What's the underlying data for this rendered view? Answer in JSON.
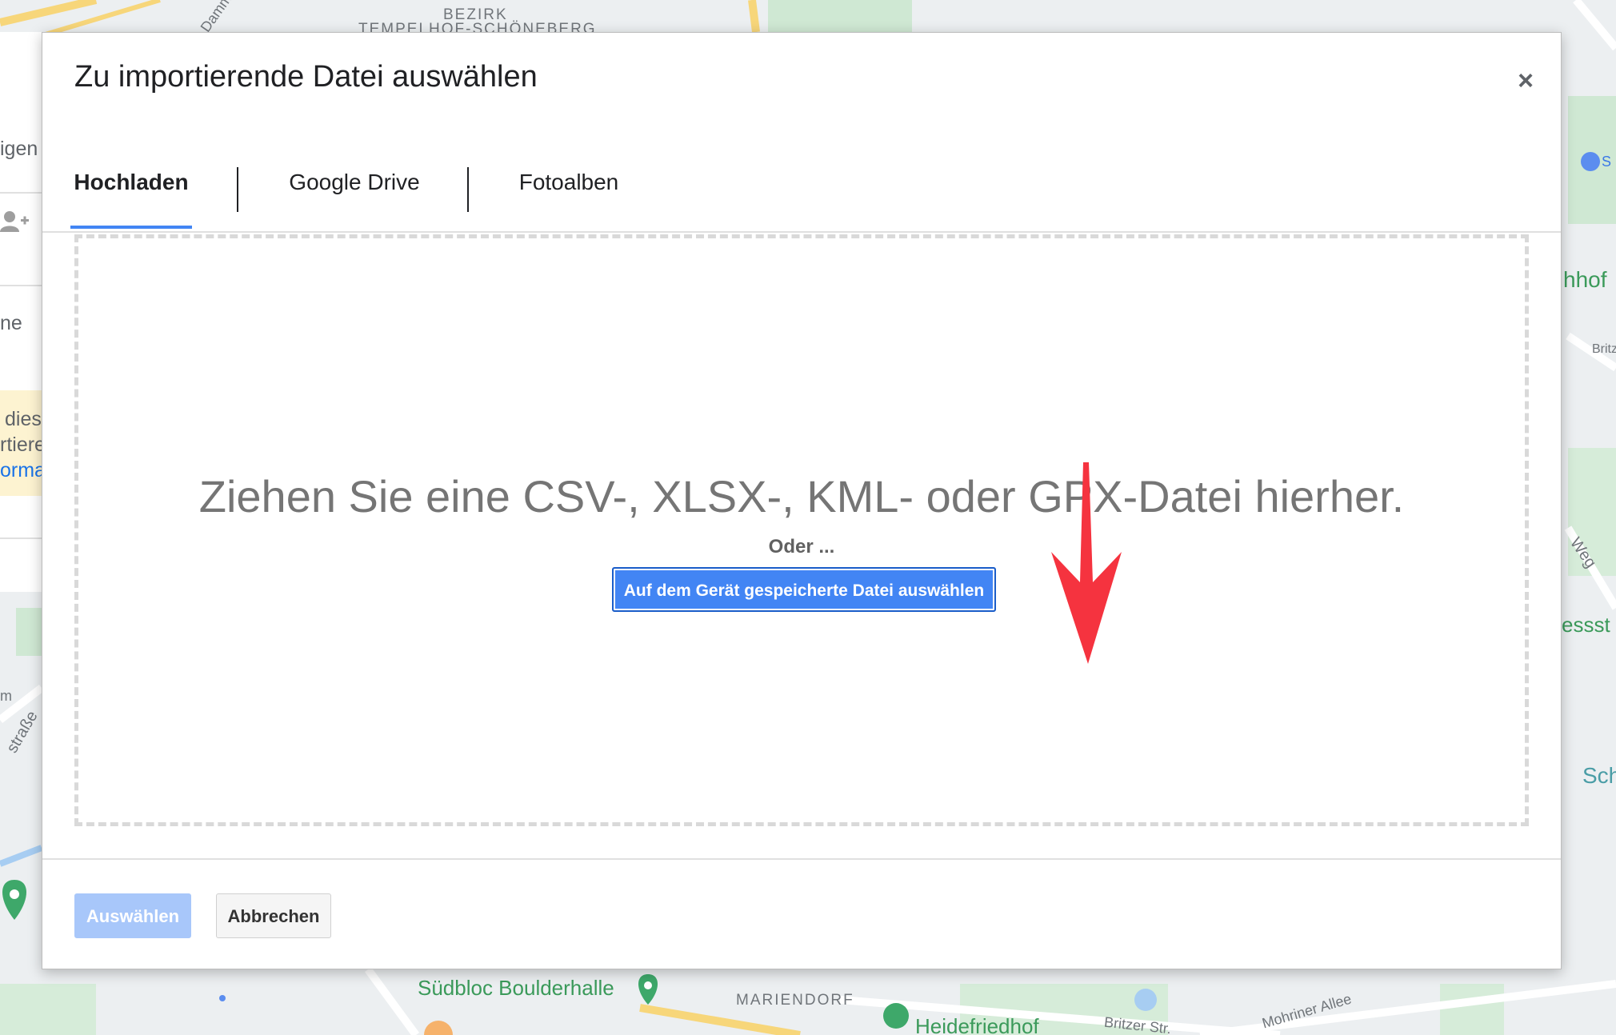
{
  "map": {
    "labels": {
      "district": "BEZIRK",
      "district_name": "TEMPELHOF-SCHÖNEBERG",
      "street_damm": "Damm",
      "station_fragment": "hhof",
      "street_britz_fragment": "Britz",
      "street_weg": "Weg",
      "street_fragment_essst": "essst",
      "area_sch": "Sch",
      "street_strasse": "straße",
      "street_m": "m",
      "poi_boulderhalle": "Südbloc Boulderhalle",
      "district_mariendorf": "MARIENDORF",
      "poi_heidefriedhof": "Heidefriedhof",
      "street_britzer": "Britzer Str.",
      "street_mohriner": "Mohriner Allee",
      "transit_s": "S"
    }
  },
  "left_panel": {
    "text_igen": "igen",
    "text_add_user": "+",
    "text_ne": "ne",
    "text_dies": "dies",
    "text_rtiere": "rtiere",
    "text_orma": "orma"
  },
  "dialog": {
    "title": "Zu importierende Datei auswählen",
    "close_label": "×",
    "tabs": [
      {
        "label": "Hochladen",
        "active": true
      },
      {
        "label": "Google Drive",
        "active": false
      },
      {
        "label": "Fotoalben",
        "active": false
      }
    ],
    "dropzone": {
      "instruction": "Ziehen Sie eine CSV-, XLSX-, KML- oder GPX-Datei hierher.",
      "or_text": "Oder ...",
      "choose_button": "Auf dem Gerät gespeicherte Datei auswählen"
    },
    "footer": {
      "select_button": "Auswählen",
      "cancel_button": "Abbrechen"
    }
  },
  "colors": {
    "accent": "#4285f4",
    "arrow": "#f5333f",
    "select_disabled": "#a8c7fa"
  }
}
